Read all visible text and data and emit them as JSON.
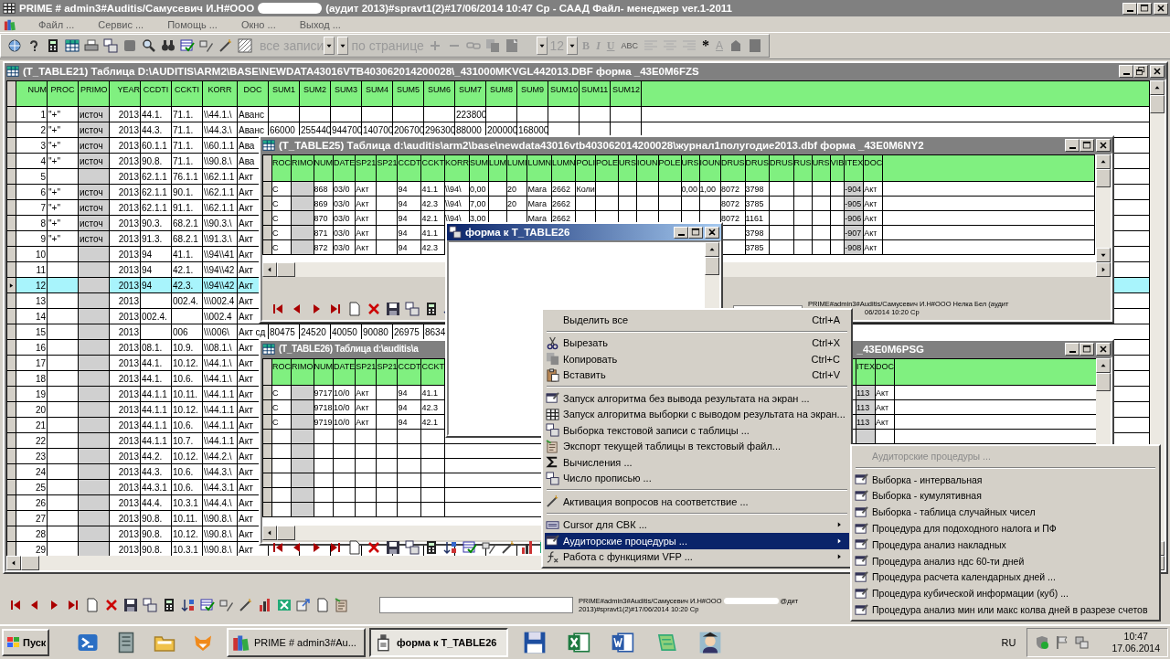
{
  "app": {
    "title_left": "PRIME # admin3#Auditis/Самусевич И.Н#ООО",
    "title_right": "(аудит 2013)#spravt1(2)#17/06/2014 10:47 Ср - СААД Файл- менеджер ver.1-2011"
  },
  "menu": [
    "Файл ...",
    "Сервис ...",
    "Помощь ...",
    "Окно ...",
    "Выход ..."
  ],
  "toolbar": {
    "record_filter": "все записи",
    "paging": "по странице",
    "font_size": "12",
    "format_buttons": [
      {
        "kind": "bold",
        "label": "B"
      },
      {
        "kind": "italic",
        "label": "I"
      },
      {
        "kind": "underline",
        "label": "U"
      },
      {
        "kind": "strike",
        "label": "ABC"
      }
    ],
    "mark": "*",
    "font_color": "A"
  },
  "table21": {
    "title": "(T_TABLE21)  Таблица D:\\AUDITIS\\ARM2\\BASE\\NEWDATA43016VTB403062014200028\\_431000MKVGL442013.DBF форма _43E0M6FZS",
    "columns": [
      {
        "label": "NUM",
        "numeric": true,
        "shaded": false
      },
      {
        "label": "PROC",
        "numeric": false,
        "shaded": false
      },
      {
        "label": "PRIMO",
        "numeric": false,
        "shaded": true
      },
      {
        "label": "YEAR",
        "numeric": true,
        "shaded": false
      },
      {
        "label": "CCDTI",
        "numeric": false,
        "shaded": false
      },
      {
        "label": "CCKTI",
        "numeric": false,
        "shaded": false
      },
      {
        "label": "KORR",
        "numeric": false,
        "shaded": false
      },
      {
        "label": "DOC",
        "numeric": false,
        "shaded": false
      },
      {
        "label": "SUM1",
        "numeric": false,
        "shaded": false
      },
      {
        "label": "SUM2",
        "numeric": false,
        "shaded": false
      },
      {
        "label": "SUM3",
        "numeric": false,
        "shaded": false
      },
      {
        "label": "SUM4",
        "numeric": false,
        "shaded": false
      },
      {
        "label": "SUM5",
        "numeric": false,
        "shaded": false
      },
      {
        "label": "SUM6",
        "numeric": false,
        "shaded": false
      },
      {
        "label": "SUM7",
        "numeric": false,
        "shaded": false
      },
      {
        "label": "SUM8",
        "numeric": false,
        "shaded": false
      },
      {
        "label": "SUM9",
        "numeric": false,
        "shaded": false
      },
      {
        "label": "SUM10",
        "numeric": false,
        "shaded": false
      },
      {
        "label": "SUM11",
        "numeric": false,
        "shaded": false
      },
      {
        "label": "SUM12",
        "numeric": false,
        "shaded": false
      }
    ],
    "rows": [
      {
        "selected": false,
        "cells": [
          "1",
          "\"+\"",
          "источ",
          "2013",
          "44.1.",
          "71.1.",
          "\\\\44.1.\\",
          "Аванс",
          null,
          null,
          null,
          null,
          null,
          null,
          "223800"
        ]
      },
      {
        "selected": false,
        "cells": [
          "2",
          "\"+\"",
          "источ",
          "2013",
          "44.3.",
          "71.1.",
          "\\\\44.3.\\",
          "Аванс",
          "66000",
          "255440",
          "944700",
          "140700",
          "206700",
          "296300",
          "88000",
          "200000",
          "168000"
        ]
      },
      {
        "selected": false,
        "cells": [
          "3",
          "\"+\"",
          "источ",
          "2013",
          "60.1.1",
          "71.1.",
          "\\\\60.1.1",
          "Ава"
        ]
      },
      {
        "selected": false,
        "cells": [
          "4",
          "\"+\"",
          "источ",
          "2013",
          "90.8.",
          "71.1.",
          "\\\\90.8.\\",
          "Ава"
        ]
      },
      {
        "selected": false,
        "cells": [
          "5",
          null,
          null,
          "2013",
          "62.1.1",
          "76.1.1",
          "\\\\62.1.1",
          "Акт"
        ]
      },
      {
        "selected": false,
        "cells": [
          "6",
          "\"+\"",
          "источ",
          "2013",
          "62.1.1",
          "90.1.",
          "\\\\62.1.1",
          "Акт"
        ]
      },
      {
        "selected": false,
        "cells": [
          "7",
          "\"+\"",
          "источ",
          "2013",
          "62.1.1",
          "91.1.",
          "\\\\62.1.1",
          "Акт"
        ]
      },
      {
        "selected": false,
        "cells": [
          "8",
          "\"+\"",
          "источ",
          "2013",
          "90.3.",
          "68.2.1",
          "\\\\90.3.\\",
          "Акт"
        ]
      },
      {
        "selected": false,
        "cells": [
          "9",
          "\"+\"",
          "источ",
          "2013",
          "91.3.",
          "68.2.1",
          "\\\\91.3.\\",
          "Акт"
        ]
      },
      {
        "selected": false,
        "cells": [
          "10",
          null,
          null,
          "2013",
          "94",
          "41.1.",
          "\\\\94\\\\41",
          "Акт"
        ]
      },
      {
        "selected": false,
        "cells": [
          "11",
          null,
          null,
          "2013",
          "94",
          "42.1.",
          "\\\\94\\\\42",
          "Акт"
        ]
      },
      {
        "selected": true,
        "cells": [
          "12",
          null,
          null,
          "2013",
          "94",
          "42.3.",
          "\\\\94\\\\42",
          "Акт"
        ]
      },
      {
        "selected": false,
        "cells": [
          "13",
          null,
          null,
          "2013",
          null,
          "002.4.",
          "\\\\\\002.4",
          "Акт"
        ]
      },
      {
        "selected": false,
        "cells": [
          "14",
          null,
          null,
          "2013",
          "002.4.",
          null,
          "\\\\002.4",
          "Акт"
        ]
      },
      {
        "selected": false,
        "cells": [
          "15",
          null,
          null,
          "2013",
          null,
          "006",
          "\\\\\\006\\",
          "Акт сд",
          "80475",
          "24520",
          "40050",
          "90080",
          "26975",
          "8634"
        ]
      },
      {
        "selected": false,
        "cells": [
          "16",
          null,
          null,
          "2013",
          "08.1.",
          "10.9.",
          "\\\\08.1.\\",
          "Акт"
        ]
      },
      {
        "selected": false,
        "cells": [
          "17",
          null,
          null,
          "2013",
          "44.1.",
          "10.12.",
          "\\\\44.1.\\",
          "Акт"
        ]
      },
      {
        "selected": false,
        "cells": [
          "18",
          null,
          null,
          "2013",
          "44.1.",
          "10.6.",
          "\\\\44.1.\\",
          "Акт"
        ]
      },
      {
        "selected": false,
        "cells": [
          "19",
          null,
          null,
          "2013",
          "44.1.1",
          "10.11.",
          "\\\\44.1.1",
          "Акт"
        ]
      },
      {
        "selected": false,
        "cells": [
          "20",
          null,
          null,
          "2013",
          "44.1.1",
          "10.12.",
          "\\\\44.1.1",
          "Акт"
        ]
      },
      {
        "selected": false,
        "cells": [
          "21",
          null,
          null,
          "2013",
          "44.1.1",
          "10.6.",
          "\\\\44.1.1",
          "Акт"
        ]
      },
      {
        "selected": false,
        "cells": [
          "22",
          null,
          null,
          "2013",
          "44.1.1",
          "10.7.",
          "\\\\44.1.1",
          "Акт"
        ]
      },
      {
        "selected": false,
        "cells": [
          "23",
          null,
          null,
          "2013",
          "44.2.",
          "10.12.",
          "\\\\44.2.\\",
          "Акт"
        ]
      },
      {
        "selected": false,
        "cells": [
          "24",
          null,
          null,
          "2013",
          "44.3.",
          "10.6.",
          "\\\\44.3.\\",
          "Акт"
        ]
      },
      {
        "selected": false,
        "cells": [
          "25",
          null,
          null,
          "2013",
          "44.3.1",
          "10.6.",
          "\\\\44.3.1",
          "Акт"
        ]
      },
      {
        "selected": false,
        "cells": [
          "26",
          null,
          null,
          "2013",
          "44.4.",
          "10.3.1",
          "\\\\44.4.\\",
          "Акт"
        ]
      },
      {
        "selected": false,
        "cells": [
          "27",
          null,
          null,
          "2013",
          "90.8.",
          "10.11.",
          "\\\\90.8.\\",
          "Акт"
        ]
      },
      {
        "selected": false,
        "cells": [
          "28",
          null,
          null,
          "2013",
          "90.8.",
          "10.12.",
          "\\\\90.8.\\",
          "Акт"
        ]
      },
      {
        "selected": false,
        "cells": [
          "29",
          null,
          null,
          "2013",
          "90.8.",
          "10.3.1",
          "\\\\90.8.\\",
          "Акт"
        ]
      }
    ]
  },
  "table25": {
    "title": "(T_TABLE25)  Таблица d:\\auditis\\arm2\\base\\newdata43016vtb403062014200028\\журнал1полугодие2013.dbf форма _43E0M6NY2",
    "columns": [
      {
        "label": "ROC",
        "shaded": false
      },
      {
        "label": "RIMO",
        "shaded": true
      },
      {
        "label": "NUM",
        "shaded": false
      },
      {
        "label": "DATE",
        "shaded": false
      },
      {
        "label": "SP21",
        "shaded": false
      },
      {
        "label": "SP21",
        "shaded": false
      },
      {
        "label": "CCDT",
        "shaded": false
      },
      {
        "label": "CCKT",
        "shaded": false
      },
      {
        "label": "KORR",
        "shaded": false
      },
      {
        "label": "SUM",
        "shaded": false
      },
      {
        "label": "LUM",
        "shaded": false
      },
      {
        "label": "LUMI",
        "shaded": false
      },
      {
        "label": "LUMN",
        "shaded": false
      },
      {
        "label": "LUMN",
        "shaded": false
      },
      {
        "label": "POLI",
        "shaded": false
      },
      {
        "label": "POLE",
        "shaded": false
      },
      {
        "label": "URS",
        "shaded": false
      },
      {
        "label": "IOUN",
        "shaded": false
      },
      {
        "label": "POLE",
        "shaded": false
      },
      {
        "label": "URS",
        "shaded": false
      },
      {
        "label": "IOUN",
        "shaded": false
      },
      {
        "label": "DRUS",
        "shaded": false
      },
      {
        "label": "DRUS",
        "shaded": false
      },
      {
        "label": "DRUS",
        "shaded": false
      },
      {
        "label": "RUS",
        "shaded": false
      },
      {
        "label": "URS",
        "shaded": false
      },
      {
        "label": "VIB",
        "shaded": false
      },
      {
        "label": "ITEX",
        "shaded": true
      },
      {
        "label": "DOC",
        "shaded": false
      }
    ],
    "rows": [
      {
        "selected": false,
        "cells": [
          "C",
          null,
          "868",
          "03/0",
          "Акт",
          null,
          "94",
          "41.1",
          "\\\\94\\",
          "0,00",
          null,
          "20",
          "Mara",
          "2662",
          "Коли",
          null,
          null,
          null,
          null,
          "0,00",
          "1,00",
          "8072",
          "3798",
          null,
          null,
          null,
          null,
          "-904",
          "Акт"
        ]
      },
      {
        "selected": false,
        "cells": [
          "C",
          null,
          "869",
          "03/0",
          "Акт",
          null,
          "94",
          "42.3",
          "\\\\94\\",
          "7,00",
          null,
          "20",
          "Mara",
          "2662",
          null,
          null,
          null,
          null,
          null,
          null,
          null,
          "8072",
          "3785",
          null,
          null,
          null,
          null,
          "-905",
          "Акт"
        ]
      },
      {
        "selected": false,
        "cells": [
          "C",
          null,
          "870",
          "03/0",
          "Акт",
          null,
          "94",
          "42.1",
          "\\\\94\\",
          "3,00",
          null,
          null,
          "Mara",
          "2662",
          null,
          null,
          null,
          null,
          null,
          null,
          null,
          "8072",
          "1161",
          null,
          null,
          null,
          null,
          "-906",
          "Акт"
        ]
      },
      {
        "selected": false,
        "cells": [
          "C",
          null,
          "871",
          "03/0",
          "Акт",
          null,
          "94",
          "41.1",
          null,
          null,
          null,
          null,
          null,
          null,
          null,
          null,
          null,
          null,
          null,
          null,
          null,
          null,
          "3798",
          null,
          null,
          null,
          null,
          "-907",
          "Акт"
        ]
      },
      {
        "selected": false,
        "cells": [
          "C",
          null,
          "872",
          "03/0",
          "Акт",
          null,
          "94",
          "42.3",
          null,
          null,
          null,
          null,
          null,
          null,
          null,
          null,
          null,
          null,
          null,
          null,
          null,
          null,
          "3785",
          null,
          null,
          null,
          null,
          "-908",
          "Акт"
        ]
      }
    ],
    "status": [
      "PRIME#admin3#Auditis/Самусевич И.Н#ООО Нелка Бел (аудит",
      "06/2014 10:20 Ср"
    ]
  },
  "table26": {
    "title": "(T_TABLE26)  Таблица d:\\auditis\\a",
    "title_tail": "_43E0M6PSG",
    "columns": [
      {
        "label": "ROC",
        "shaded": false
      },
      {
        "label": "RIMO",
        "shaded": true
      },
      {
        "label": "NUM",
        "shaded": false
      },
      {
        "label": "DATE",
        "shaded": false
      },
      {
        "label": "SP21",
        "shaded": false
      },
      {
        "label": "SP21",
        "shaded": false
      },
      {
        "label": "CCDT",
        "shaded": false
      },
      {
        "label": "CCKT",
        "shaded": false
      }
    ],
    "tail_columns": [
      {
        "label": "ITEX",
        "shaded": true
      },
      {
        "label": "DOC",
        "shaded": false
      }
    ],
    "rows": [
      {
        "selected": false,
        "cells": [
          "C",
          null,
          "9717",
          "10/0",
          "Акт",
          null,
          "94",
          "41.1"
        ],
        "tail": [
          "113",
          "Акт"
        ]
      },
      {
        "selected": false,
        "cells": [
          "C",
          null,
          "9718",
          "10/0",
          "Акт",
          null,
          "94",
          "42.3"
        ],
        "tail": [
          "113",
          "Акт"
        ]
      },
      {
        "selected": false,
        "cells": [
          "C",
          null,
          "9719",
          "10/0",
          "Акт",
          null,
          "94",
          "42.1"
        ],
        "tail": [
          "113",
          "Акт"
        ]
      }
    ]
  },
  "form": {
    "title": "форма к T_TABLE26"
  },
  "context_menu": [
    {
      "kind": "item",
      "label": "Выделить все",
      "shortcut": "Ctrl+A",
      "submenu": false,
      "selected": false
    },
    {
      "kind": "separator"
    },
    {
      "kind": "item",
      "label": "Вырезать",
      "shortcut": "Ctrl+X",
      "submenu": false,
      "selected": false
    },
    {
      "kind": "item",
      "label": "Копировать",
      "shortcut": "Ctrl+C",
      "submenu": false,
      "selected": false
    },
    {
      "kind": "item",
      "label": "Вставить",
      "shortcut": "Ctrl+V",
      "submenu": false,
      "selected": false
    },
    {
      "kind": "separator"
    },
    {
      "kind": "item",
      "label": "Запуск алгоритма без вывода результата на экран ...",
      "submenu": false,
      "selected": false
    },
    {
      "kind": "item",
      "label": "Запуск алгоритма выборки с выводом результата на экран...",
      "submenu": false,
      "selected": false
    },
    {
      "kind": "item",
      "label": "Выборка текстовой записи с таблицы ...",
      "submenu": false,
      "selected": false
    },
    {
      "kind": "item",
      "label": "Экспорт текущей таблицы в текстовый файл...",
      "submenu": false,
      "selected": false
    },
    {
      "kind": "item",
      "label": "Вычисления ...",
      "submenu": false,
      "selected": false
    },
    {
      "kind": "item",
      "label": "Число прописью ...",
      "submenu": false,
      "selected": false
    },
    {
      "kind": "separator"
    },
    {
      "kind": "item",
      "label": "Активация вопросов на соответствие ...",
      "submenu": false,
      "selected": false
    },
    {
      "kind": "separator"
    },
    {
      "kind": "item",
      "label": "Cursor для СВК ...",
      "submenu": true,
      "selected": false
    },
    {
      "kind": "item",
      "label": "Аудиторские процедуры ...",
      "submenu": true,
      "selected": true
    },
    {
      "kind": "item",
      "label": "Работа с функциями VFP ...",
      "submenu": true,
      "selected": false
    }
  ],
  "submenu": {
    "header": "Аудиторские процедуры ...",
    "items": [
      "Выборка - интервальная",
      "Выборка - кумулятивная",
      "Выборка - таблица случайных чисел",
      "Процедура для подоходного налога и ПФ",
      "Процедура анализ накладных",
      "Процедура анализ ндс 60-ти дней",
      "Процедура расчета календарных дней ...",
      "Процедура кубической информации (куб) ...",
      "Процедура анализ мин или макс колва дней в разрезе счетов"
    ]
  },
  "status": {
    "line1_left": "PRIME#admin3#Auditis/Самусевич И.Н#ООО",
    "line1_right": "@дит",
    "line2": "2013)#spravt1(2)#17/06/2014 10:20 Ср"
  },
  "taskbar": {
    "start": "Пуск",
    "tasks": [
      {
        "label": "PRIME # admin3#Au...",
        "selected": false
      },
      {
        "label": "форма к T_TABLE26",
        "selected": true
      }
    ],
    "language": "RU",
    "time": "10:47",
    "date": "17.06.2014"
  }
}
